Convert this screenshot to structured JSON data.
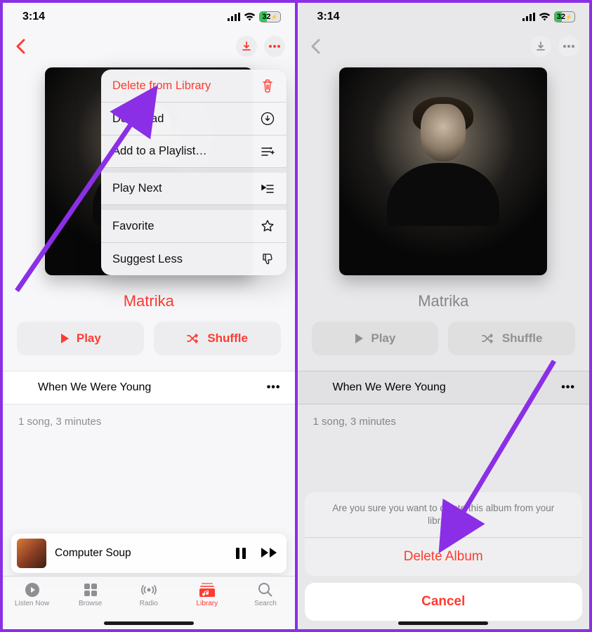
{
  "status": {
    "time": "3:14",
    "battery": "32"
  },
  "nav": {
    "back": "‹"
  },
  "album": {
    "title": "Matrika",
    "play": "Play",
    "shuffle": "Shuffle",
    "meta": "1 song, 3 minutes"
  },
  "track": {
    "title": "When We Were Young"
  },
  "menu": {
    "delete": "Delete from Library",
    "download": "Download",
    "add_playlist": "Add to a Playlist…",
    "play_next": "Play Next",
    "favorite": "Favorite",
    "suggest_less": "Suggest Less"
  },
  "nowplaying": {
    "title": "Computer Soup"
  },
  "tabs": {
    "listen": "Listen Now",
    "browse": "Browse",
    "radio": "Radio",
    "library": "Library",
    "search": "Search"
  },
  "sheet": {
    "message": "Are you sure you want to delete this album from your library?",
    "delete": "Delete Album",
    "cancel": "Cancel"
  }
}
